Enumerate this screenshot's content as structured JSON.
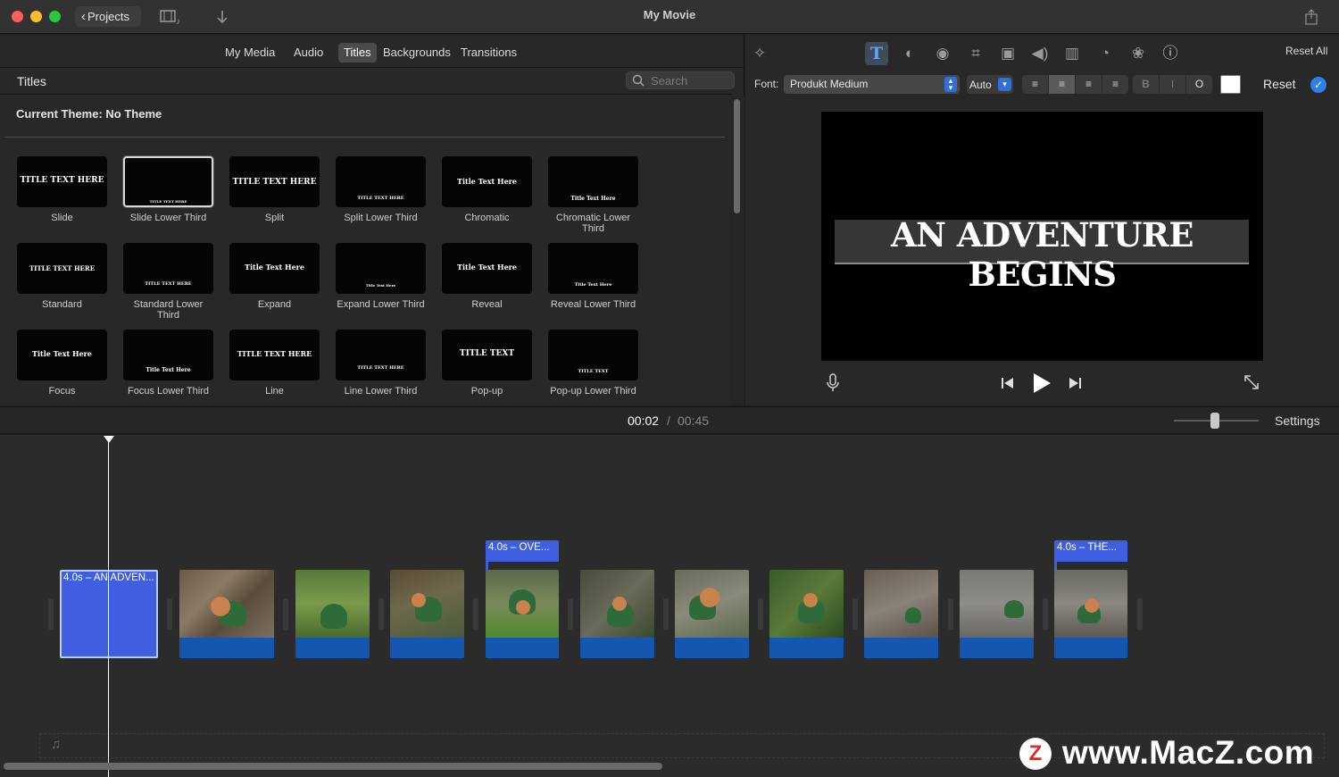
{
  "window": {
    "title": "My Movie",
    "projects_label": "Projects"
  },
  "browser": {
    "tabs": [
      {
        "label": "My Media",
        "active": false
      },
      {
        "label": "Audio",
        "active": false
      },
      {
        "label": "Titles",
        "active": true
      },
      {
        "label": "Backgrounds",
        "active": false
      },
      {
        "label": "Transitions",
        "active": false
      }
    ],
    "section_title": "Titles",
    "search_placeholder": "Search",
    "theme_label": "Current Theme: No Theme",
    "titles": [
      {
        "name": "Slide",
        "preview": "TITLE TEXT HERE"
      },
      {
        "name": "Slide Lower Third",
        "preview": "TITLE TEXT HERE"
      },
      {
        "name": "Split",
        "preview": "TITLE TEXT HERE"
      },
      {
        "name": "Split Lower Third",
        "preview": "TITLE TEXT HERE"
      },
      {
        "name": "Chromatic",
        "preview": "Title Text Here"
      },
      {
        "name": "Chromatic Lower Third",
        "preview": "Title Text Here"
      },
      {
        "name": "Standard",
        "preview": "TITLE TEXT HERE"
      },
      {
        "name": "Standard Lower Third",
        "preview": "TITLE TEXT HERE"
      },
      {
        "name": "Expand",
        "preview": "Title Text Here"
      },
      {
        "name": "Expand Lower Third",
        "preview": "Title Text Here"
      },
      {
        "name": "Reveal",
        "preview": "Title Text Here"
      },
      {
        "name": "Reveal Lower Third",
        "preview": "Title Text Here"
      },
      {
        "name": "Focus",
        "preview": "Title Text Here"
      },
      {
        "name": "Focus Lower Third",
        "preview": "Title Text Here"
      },
      {
        "name": "Line",
        "preview": "TITLE TEXT HERE"
      },
      {
        "name": "Line Lower Third",
        "preview": "TITLE TEXT HERE"
      },
      {
        "name": "Pop-up",
        "preview": "TITLE TEXT"
      },
      {
        "name": "Pop-up Lower Third",
        "preview": "TITLE TEXT"
      }
    ]
  },
  "viewer": {
    "reset_all_label": "Reset All",
    "font_label": "Font:",
    "font_value": "Produkt Medium",
    "size_value": "Auto",
    "bold_label": "B",
    "italic_label": "I",
    "outline_label": "O",
    "reset_label": "Reset",
    "preview_title": "AN ADVENTURE BEGINS",
    "text_color": "#ffffff"
  },
  "timeline": {
    "current_time": "00:02",
    "separator": "/",
    "total_time": "00:45",
    "settings_label": "Settings",
    "title_clips": [
      {
        "label": "4.0s – AN ADVEN..."
      },
      {
        "label": "4.0s – OVE..."
      },
      {
        "label": "4.0s – THE..."
      }
    ],
    "accent_color": "#3f5fe0",
    "audio_color": "#1556b0"
  },
  "watermark": {
    "text": "www.MacZ.com",
    "logo_letter": "Z"
  }
}
